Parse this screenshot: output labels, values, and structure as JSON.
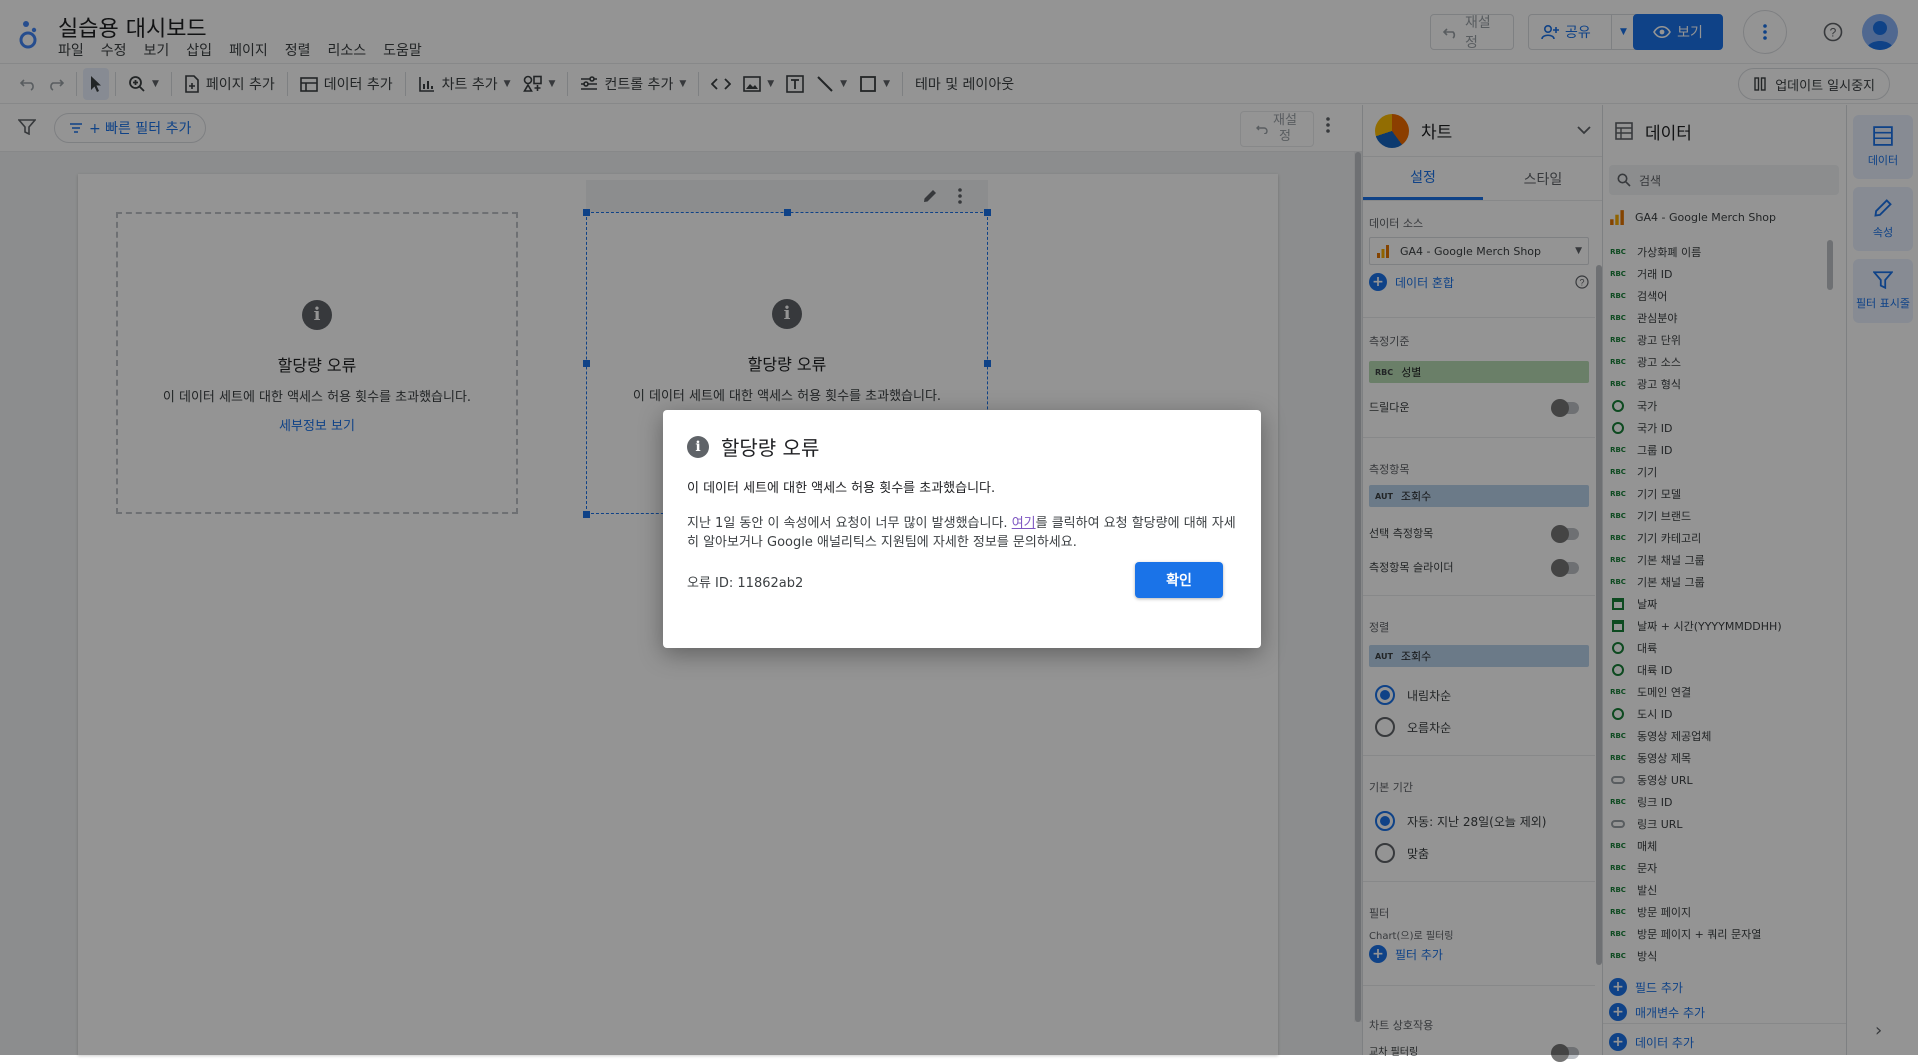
{
  "header": {
    "title": "실습용 대시보드",
    "menu": [
      "파일",
      "수정",
      "보기",
      "삽입",
      "페이지",
      "정렬",
      "리소스",
      "도움말"
    ],
    "reset_label": "재설정",
    "share_label": "공유",
    "view_label": "보기"
  },
  "toolbar": {
    "add_page": "페이지 추가",
    "add_data": "데이터 추가",
    "add_chart": "차트 추가",
    "add_control": "컨트롤 추가",
    "theme": "테마 및 레이아웃",
    "pause_updates": "업데이트 일시중지"
  },
  "filterbar": {
    "quick_filter": "+ 빠른 필터 추가",
    "reset_label": "재설정"
  },
  "charts": [
    {
      "title": "할당량 오류",
      "desc": "이 데이터 세트에 대한 액세스 허용 횟수를 초과했습니다.",
      "link": "세부정보 보기"
    },
    {
      "title": "할당량 오류",
      "desc": "이 데이터 세트에 대한 액세스 허용 횟수를 초과했습니다."
    }
  ],
  "dialog": {
    "title": "할당량 오류",
    "message": "이 데이터 세트에 대한 액세스 허용 횟수를 초과했습니다.",
    "detail_before": "지난 1일 동안 이 속성에서 요청이 너무 많이 발생했습니다. ",
    "detail_link": "여기",
    "detail_after": "를 클릭하여 요청 할당량에 대해 자세히 알아보거나 Google 애널리틱스 지원팀에 자세한 정보를 문의하세요.",
    "error_id": "오류 ID: 11862ab2",
    "ok_label": "확인"
  },
  "chart_panel": {
    "title": "차트",
    "tabs": [
      "설정",
      "스타일"
    ],
    "data_source_label": "데이터 소스",
    "data_source": "GA4 - Google Merch Shop",
    "blend_data": "데이터 혼합",
    "dimension_label": "측정기준",
    "dimension": "성별",
    "dimension_type": "RBC",
    "drilldown": "드릴다운",
    "metric_label": "측정항목",
    "metric": "조회수",
    "metric_type": "AUT",
    "optional_metric": "선택 측정항목",
    "metric_slider": "측정항목 슬라이더",
    "sort_label": "정렬",
    "sort_metric": "조회수",
    "sort_type": "AUT",
    "sort_desc": "내림차순",
    "sort_asc": "오름차순",
    "default_range_label": "기본 기간",
    "range_auto": "자동: 지난 28일(오늘 제외)",
    "range_custom": "맞춤",
    "filter_label": "필터",
    "filter_sub": "Chart(으)로 필터링",
    "add_filter": "필터 추가",
    "interaction_label": "차트 상호작용",
    "cross_filter": "교차 필터링"
  },
  "data_panel": {
    "title": "데이터",
    "search_placeholder": "검색",
    "source": "GA4 - Google Merch Shop",
    "fields": [
      {
        "type": "rbc",
        "name": "가상화폐 이름"
      },
      {
        "type": "rbc",
        "name": "거래 ID"
      },
      {
        "type": "rbc",
        "name": "검색어"
      },
      {
        "type": "rbc",
        "name": "관심분야"
      },
      {
        "type": "rbc",
        "name": "광고 단위"
      },
      {
        "type": "rbc",
        "name": "광고 소스"
      },
      {
        "type": "rbc",
        "name": "광고 형식"
      },
      {
        "type": "geo",
        "name": "국가"
      },
      {
        "type": "geo",
        "name": "국가 ID"
      },
      {
        "type": "rbc",
        "name": "그룹 ID"
      },
      {
        "type": "rbc",
        "name": "기기"
      },
      {
        "type": "rbc",
        "name": "기기 모델"
      },
      {
        "type": "rbc",
        "name": "기기 브랜드"
      },
      {
        "type": "rbc",
        "name": "기기 카테고리"
      },
      {
        "type": "rbc",
        "name": "기본 채널 그룹"
      },
      {
        "type": "rbc",
        "name": "기본 채널 그룹"
      },
      {
        "type": "date",
        "name": "날짜"
      },
      {
        "type": "date",
        "name": "날짜 + 시간(YYYYMMDDHH)"
      },
      {
        "type": "geo",
        "name": "대륙"
      },
      {
        "type": "geo",
        "name": "대륙 ID"
      },
      {
        "type": "rbc",
        "name": "도메인 연결"
      },
      {
        "type": "geo",
        "name": "도시 ID"
      },
      {
        "type": "rbc",
        "name": "동영상 제공업체"
      },
      {
        "type": "rbc",
        "name": "동영상 제목"
      },
      {
        "type": "link",
        "name": "동영상 URL"
      },
      {
        "type": "rbc",
        "name": "링크 ID"
      },
      {
        "type": "link",
        "name": "링크 URL"
      },
      {
        "type": "rbc",
        "name": "매체"
      },
      {
        "type": "rbc",
        "name": "문자"
      },
      {
        "type": "rbc",
        "name": "발신"
      },
      {
        "type": "rbc",
        "name": "방문 페이지"
      },
      {
        "type": "rbc",
        "name": "방문 페이지 + 쿼리 문자열"
      },
      {
        "type": "rbc",
        "name": "방식"
      }
    ],
    "add_field": "필드 추가",
    "add_param": "매개변수 추가",
    "add_data": "데이터 추가"
  },
  "rail": {
    "data": "데이터",
    "properties": "속성",
    "filter": "필터 표시줄"
  },
  "colors": {
    "accent": "#1a73e8",
    "dimension_chip": "#b7dbb3",
    "metric_chip": "#b9d2ea"
  }
}
